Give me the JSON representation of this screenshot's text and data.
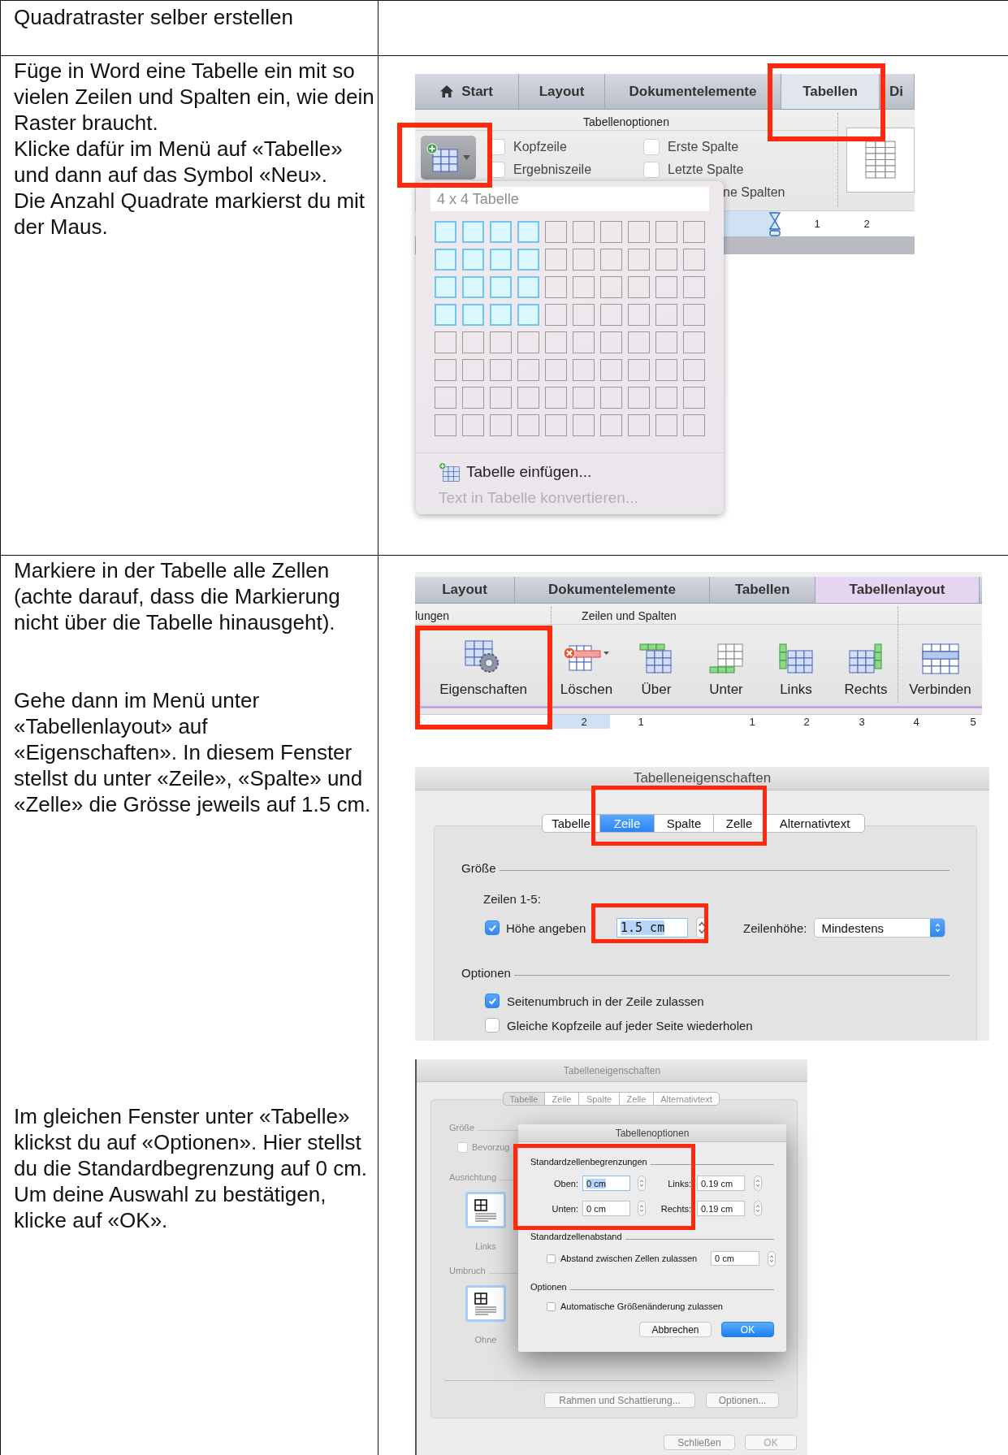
{
  "rows": [
    {
      "instructions": [
        "Quadratraster selber erstellen"
      ]
    },
    {
      "instructions": [
        "Füge in Word eine Tabelle ein mit so vielen Zeilen und Spalten ein, wie dein Raster braucht.",
        "Klicke dafür im Menü auf «Tabelle» und dann auf das Symbol «Neu».",
        "Die Anzahl Quadrate markierst du mit der Maus."
      ],
      "figures": [
        {
          "kind": "ribbon_gallery",
          "tabs": [
            {
              "label": "Start",
              "selected": false
            },
            {
              "label": "Layout",
              "selected": false
            },
            {
              "label": "Dokumentelemente",
              "selected": false
            },
            {
              "label": "Tabellen",
              "selected": true
            },
            {
              "label": "Di",
              "selected": false
            }
          ],
          "group_title": "Tabellenoptionen",
          "options": [
            {
              "label": "Kopfzeile",
              "checked": false
            },
            {
              "label": "Ergebniszeile",
              "checked": false
            },
            {
              "label": "Erste Spalte",
              "checked": false
            },
            {
              "label": "Letzte Spalte",
              "checked": false
            }
          ],
          "partial_option": "ne Spalten",
          "ruler": [
            "1",
            "2"
          ],
          "dropdown": {
            "header": "4 x 4 Tabelle",
            "grid": [
              {
                "cells": [
                  {
                    "selected": true
                  },
                  {
                    "selected": true
                  },
                  {
                    "selected": true
                  },
                  {
                    "selected": true
                  },
                  {
                    "selected": false
                  },
                  {
                    "selected": false
                  },
                  {
                    "selected": false
                  },
                  {
                    "selected": false
                  },
                  {
                    "selected": false
                  },
                  {
                    "selected": false
                  }
                ]
              },
              {
                "cells": [
                  {
                    "selected": true
                  },
                  {
                    "selected": true
                  },
                  {
                    "selected": true
                  },
                  {
                    "selected": true
                  },
                  {
                    "selected": false
                  },
                  {
                    "selected": false
                  },
                  {
                    "selected": false
                  },
                  {
                    "selected": false
                  },
                  {
                    "selected": false
                  },
                  {
                    "selected": false
                  }
                ]
              },
              {
                "cells": [
                  {
                    "selected": true
                  },
                  {
                    "selected": true
                  },
                  {
                    "selected": true
                  },
                  {
                    "selected": true
                  },
                  {
                    "selected": false
                  },
                  {
                    "selected": false
                  },
                  {
                    "selected": false
                  },
                  {
                    "selected": false
                  },
                  {
                    "selected": false
                  },
                  {
                    "selected": false
                  }
                ]
              },
              {
                "cells": [
                  {
                    "selected": true
                  },
                  {
                    "selected": true
                  },
                  {
                    "selected": true
                  },
                  {
                    "selected": true
                  },
                  {
                    "selected": false
                  },
                  {
                    "selected": false
                  },
                  {
                    "selected": false
                  },
                  {
                    "selected": false
                  },
                  {
                    "selected": false
                  },
                  {
                    "selected": false
                  }
                ]
              },
              {
                "cells": [
                  {
                    "selected": false
                  },
                  {
                    "selected": false
                  },
                  {
                    "selected": false
                  },
                  {
                    "selected": false
                  },
                  {
                    "selected": false
                  },
                  {
                    "selected": false
                  },
                  {
                    "selected": false
                  },
                  {
                    "selected": false
                  },
                  {
                    "selected": false
                  },
                  {
                    "selected": false
                  }
                ]
              },
              {
                "cells": [
                  {
                    "selected": false
                  },
                  {
                    "selected": false
                  },
                  {
                    "selected": false
                  },
                  {
                    "selected": false
                  },
                  {
                    "selected": false
                  },
                  {
                    "selected": false
                  },
                  {
                    "selected": false
                  },
                  {
                    "selected": false
                  },
                  {
                    "selected": false
                  },
                  {
                    "selected": false
                  }
                ]
              },
              {
                "cells": [
                  {
                    "selected": false
                  },
                  {
                    "selected": false
                  },
                  {
                    "selected": false
                  },
                  {
                    "selected": false
                  },
                  {
                    "selected": false
                  },
                  {
                    "selected": false
                  },
                  {
                    "selected": false
                  },
                  {
                    "selected": false
                  },
                  {
                    "selected": false
                  },
                  {
                    "selected": false
                  }
                ]
              },
              {
                "cells": [
                  {
                    "selected": false
                  },
                  {
                    "selected": false
                  },
                  {
                    "selected": false
                  },
                  {
                    "selected": false
                  },
                  {
                    "selected": false
                  },
                  {
                    "selected": false
                  },
                  {
                    "selected": false
                  },
                  {
                    "selected": false
                  },
                  {
                    "selected": false
                  },
                  {
                    "selected": false
                  }
                ]
              }
            ],
            "menu": [
              {
                "label": "Tabelle einfügen...",
                "disabled": false
              },
              {
                "label": "Text in Tabelle konvertieren...",
                "disabled": true
              }
            ]
          }
        }
      ]
    },
    {
      "instructions": [
        "Markiere in der Tabelle alle Zellen (achte darauf, dass die Markierung nicht über die Tabelle hinausgeht).",
        "Gehe dann im Menü unter «Tabellenlayout» auf «Eigenschaften». In diesem Fenster stellst du unter «Zeile», «Spalte» und «Zelle» die Grösse jeweils auf 1.5 cm.",
        "Im gleichen Fenster unter «Tabelle» klickst du auf «Optionen». Hier stellst du die Standardbegrenzung auf 0 cm. Um deine Auswahl zu bestätigen, klicke auf «OK»."
      ],
      "figures": [
        {
          "kind": "ribbon_buttons",
          "tabs": [
            {
              "label": "Layout",
              "selected": false
            },
            {
              "label": "Dokumentelemente",
              "selected": false
            },
            {
              "label": "Tabellen",
              "selected": false
            },
            {
              "label": "Tabellenlayout",
              "selected": true
            }
          ],
          "groups": [
            {
              "title": "lungen",
              "buttons": [
                {
                  "label": "Eigenschaften",
                  "kind": "properties"
                }
              ]
            },
            {
              "title": "Zeilen und Spalten",
              "buttons": [
                {
                  "label": "Löschen",
                  "kind": "delete"
                },
                {
                  "label": "Über",
                  "kind": "above"
                },
                {
                  "label": "Unter",
                  "kind": "below"
                },
                {
                  "label": "Links",
                  "kind": "left"
                },
                {
                  "label": "Rechts",
                  "kind": "right"
                }
              ]
            },
            {
              "buttons": [
                {
                  "label": "Verbinden",
                  "kind": "merge"
                }
              ]
            }
          ],
          "ruler": [
            "2",
            "1",
            "1",
            "2",
            "3",
            "4",
            "5"
          ]
        },
        {
          "kind": "dialog_row",
          "title": "Tabelleneigenschaften",
          "tabs": [
            {
              "label": "Tabelle",
              "selected": false
            },
            {
              "label": "Zeile",
              "selected": true
            },
            {
              "label": "Spalte",
              "selected": false
            },
            {
              "label": "Zelle",
              "selected": false
            },
            {
              "label": "Alternativtext",
              "selected": false
            }
          ],
          "size": {
            "heading": "Größe",
            "subheading": "Zeilen 1-5:",
            "height_check": {
              "label": "Höhe angeben",
              "checked": true
            },
            "height_value": "1.5 cm",
            "row_height_label": "Zeilenhöhe:",
            "row_height_mode": "Mindestens"
          },
          "options": {
            "heading": "Optionen",
            "checks": [
              {
                "label": "Seitenumbruch in der Zeile zulassen",
                "checked": true
              },
              {
                "label": "Gleiche Kopfzeile auf jeder Seite wiederholen",
                "checked": false
              }
            ]
          }
        },
        {
          "kind": "dialog_options",
          "background": {
            "title": "Tabelleneigenschaften",
            "tabs": [
              {
                "label": "Tabelle",
                "selected": true
              },
              {
                "label": "Zeile",
                "selected": false
              },
              {
                "label": "Spalte",
                "selected": false
              },
              {
                "label": "Zelle",
                "selected": false
              },
              {
                "label": "Alternativtext",
                "selected": false
              }
            ],
            "size_heading": "Größe",
            "preferred": {
              "label": "Bevorzug",
              "checked": false
            },
            "alignment_heading": "Ausrichtung",
            "alignment_label": "Links",
            "wrap_heading": "Umbruch",
            "wrap_label": "Ohne",
            "buttons": [
              "Rahmen und Schattierung...",
              "Optionen..."
            ],
            "footer_buttons": [
              {
                "label": "Schließen",
                "disabled": false
              },
              {
                "label": "OK",
                "disabled": true
              }
            ]
          },
          "sheet": {
            "title": "Tabellenoptionen",
            "margins_heading": "Standardzellenbegrenzungen",
            "margins": [
              {
                "label": "Oben:",
                "value": "0 cm",
                "selected": true
              },
              {
                "label": "Links:",
                "value": "0.19 cm",
                "selected": false
              },
              {
                "label": "Unten:",
                "value": "0 cm",
                "selected": false
              },
              {
                "label": "Rechts:",
                "value": "0.19 cm",
                "selected": false
              }
            ],
            "spacing_heading": "Standardzellenabstand",
            "spacing": {
              "label": "Abstand zwischen Zellen zulassen",
              "checked": false,
              "value": "0 cm"
            },
            "options_heading": "Optionen",
            "auto_resize": {
              "label": "Automatische Größenänderung zulassen",
              "checked": false
            },
            "buttons": [
              {
                "label": "Abbrechen",
                "kind": "secondary"
              },
              {
                "label": "OK",
                "kind": "primary"
              }
            ]
          }
        }
      ]
    }
  ]
}
